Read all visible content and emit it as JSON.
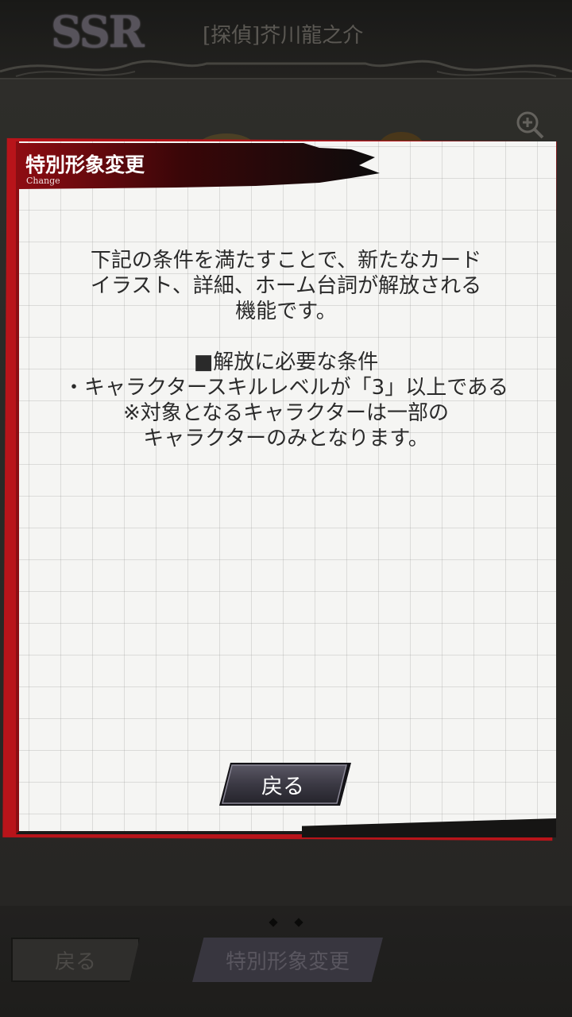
{
  "header": {
    "rarity": "SSR",
    "card_name": "[探偵]芥川龍之介"
  },
  "icons": {
    "zoom": "zoom-in-icon"
  },
  "modal": {
    "title": "特別形象変更",
    "subtitle": "Change",
    "body_lines": [
      "下記の条件を満たすことで、新たなカード",
      "イラスト、詳細、ホーム台詞が解放される",
      "機能です。",
      "",
      "■解放に必要な条件",
      "・キャラクタースキルレベルが「3」以上である",
      "※対象となるキャラクターは一部の",
      "キャラクターのみとなります。"
    ],
    "back_label": "戻る"
  },
  "bottom": {
    "back_label": "戻る",
    "special_change_label": "特別形象変更"
  },
  "colors": {
    "accent_red": "#b8141a",
    "paper": "#f5f5f3",
    "button_dark": "#3b3944"
  }
}
